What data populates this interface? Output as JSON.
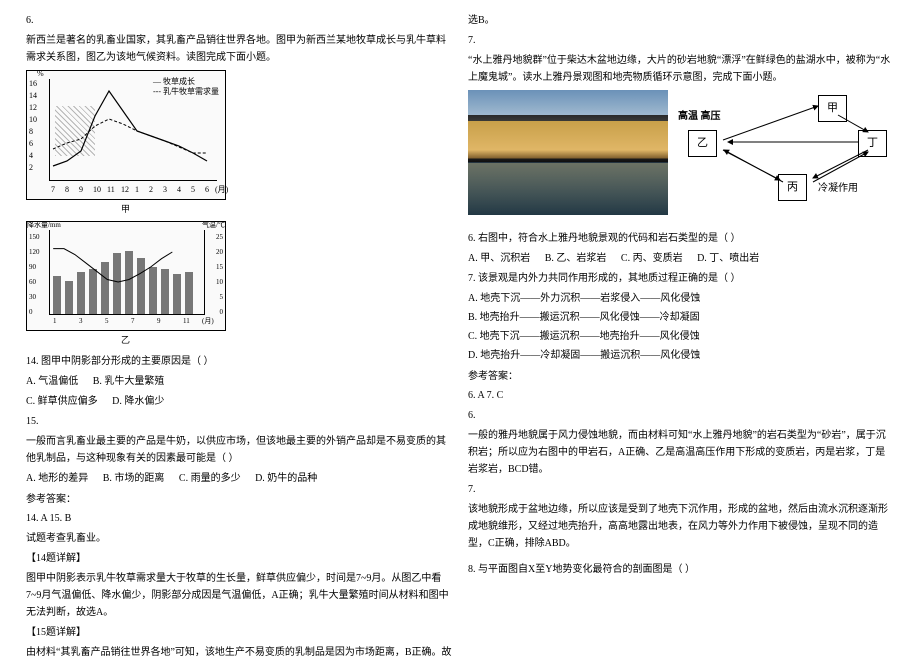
{
  "left": {
    "q6_num": "6.",
    "q6_intro": "新西兰是著名的乳畜业国家，其乳畜产品销往世界各地。图甲为新西兰某地牧草成长与乳牛草料需求关系图，图乙为该地气候资料。读图完成下面小题。",
    "chart1": {
      "y_unit": "%",
      "y_ticks": [
        "16",
        "14",
        "12",
        "10",
        "8",
        "6",
        "4",
        "2"
      ],
      "x_ticks": [
        "7",
        "8",
        "9",
        "10",
        "11",
        "12",
        "1",
        "2",
        "3",
        "4",
        "5",
        "6"
      ],
      "x_unit": "(月)",
      "legend_solid": "— 牧草成长",
      "legend_dash": "--- 乳牛牧草需求量",
      "label_jia": "甲"
    },
    "chart2": {
      "left_title": "降水量/mm",
      "right_title": "气温/℃",
      "y_left": [
        "150",
        "120",
        "90",
        "60",
        "30",
        "0"
      ],
      "y_right": [
        "25",
        "20",
        "15",
        "10",
        "5",
        "0"
      ],
      "x_ticks": [
        "1",
        "3",
        "5",
        "7",
        "9",
        "11"
      ],
      "x_unit": "(月)",
      "label_yi": "乙"
    },
    "q14_stem": "14. 图甲中阴影部分形成的主要原因是（  ）",
    "q14_opts": {
      "A": "A. 气温偏低",
      "B": "B. 乳牛大量繁殖",
      "C": "C. 鲜草供应偏多",
      "D": "D. 降水偏少"
    },
    "q15_num": "15.",
    "q15_stem": "一般而言乳畜业最主要的产品是牛奶，以供应市场，但该地最主要的外销产品却是不易变质的其他乳制品，与这种现象有关的因素最可能是（  ）",
    "q15_opts": {
      "A": "A. 地形的差异",
      "B": "B. 市场的距离",
      "C": "C. 雨量的多少",
      "D": "D. 奶牛的品种"
    },
    "ans_label": "参考答案：",
    "ans_line": "14. A    15. B",
    "ans_note": "试题考查乳畜业。",
    "explain14_title": "【14题详解】",
    "explain14_body": "图甲中阴影表示乳牛牧草需求量大于牧草的生长量，鲜草供应偏少，时间是7~9月。从图乙中看7~9月气温偏低、降水偏少，阴影部分成因是气温偏低，A正确；乳牛大量繁殖时间从材料和图中无法判断，故选A。",
    "explain15_title": "【15题详解】",
    "explain15_body": "由材料“其乳畜产品销往世界各地”可知，该地生产不易变质的乳制品是因为市场距离，B正确。故"
  },
  "right": {
    "cont": "选B。",
    "q7_num": "7.",
    "q7_intro": "“水上雅丹地貌群”位于柴达木盆地边缘，大片的砂岩地貌“漂浮”在鲜绿色的盐湖水中，被称为“水上魔鬼城”。读水上雅丹景观图和地壳物质循环示意图，完成下面小题。",
    "diagram": {
      "top_label": "高温 高压",
      "box_jia": "甲",
      "box_yi": "乙",
      "box_bing": "丙",
      "box_ding": "丁",
      "bottom_label": "冷凝作用"
    },
    "q6r_stem": "6. 右图中，符合水上雅丹地貌景观的代码和岩石类型的是（  ）",
    "q6r_opts": {
      "A": "A. 甲、沉积岩",
      "B": "B. 乙、岩浆岩",
      "C": "C. 丙、变质岩",
      "D": "D. 丁、喷出岩"
    },
    "q7r_stem": "7. 该景观是内外力共同作用形成的，其地质过程正确的是（  ）",
    "q7r_opts": {
      "A": "A. 地壳下沉——外力沉积——岩浆侵入——风化侵蚀",
      "B": "B. 地壳抬升——搬运沉积——风化侵蚀——冷却凝固",
      "C": "C. 地壳下沉——搬运沉积——地壳抬升——风化侵蚀",
      "D": "D. 地壳抬升——冷却凝固——搬运沉积——风化侵蚀"
    },
    "ans_label": "参考答案：",
    "ans_line": "6. A    7. C",
    "exp6_num": "6.",
    "exp6_body": "一般的雅丹地貌属于风力侵蚀地貌，而由材料可知“水上雅丹地貌”的岩石类型为“砂岩”，属于沉积岩；所以应为右图中的甲岩石，A正确、乙是高温高压作用下形成的变质岩，丙是岩浆，丁是岩浆岩，BCD错。",
    "exp7_num": "7.",
    "exp7_body": "该地貌形成于盆地边缘，所以应该是受到了地壳下沉作用，形成的盆地，然后由流水沉积逐渐形成地貌维形，又经过地壳抬升，高高地露出地表，在风力等外力作用下被侵蚀，呈现不同的造型，C正确，排除ABD。",
    "q8_stem": "8. 与平面图自X至Y地势变化最符合的剖面图是（  ）"
  },
  "chart_data": [
    {
      "type": "line",
      "title": "甲",
      "xlabel": "月",
      "ylabel": "%",
      "categories": [
        "7",
        "8",
        "9",
        "10",
        "11",
        "12",
        "1",
        "2",
        "3",
        "4",
        "5",
        "6"
      ],
      "ylim": [
        0,
        16
      ],
      "series": [
        {
          "name": "牧草成长",
          "values": [
            2,
            3,
            5,
            10,
            14,
            11,
            8,
            7,
            6,
            5,
            4,
            3
          ]
        },
        {
          "name": "乳牛牧草需求量",
          "values": [
            5,
            6,
            7,
            9,
            10,
            9,
            8,
            7,
            6,
            5,
            4,
            4
          ]
        }
      ]
    },
    {
      "type": "bar",
      "title": "乙",
      "xlabel": "月",
      "ylabel": "降水量/mm",
      "y2label": "气温/℃",
      "categories": [
        "1",
        "2",
        "3",
        "4",
        "5",
        "6",
        "7",
        "8",
        "9",
        "10",
        "11",
        "12"
      ],
      "ylim": [
        0,
        150
      ],
      "y2lim": [
        0,
        25
      ],
      "series": [
        {
          "name": "降水量",
          "axis": "left",
          "values": [
            80,
            70,
            90,
            95,
            110,
            130,
            135,
            120,
            100,
            95,
            85,
            90
          ]
        },
        {
          "name": "气温",
          "axis": "right",
          "values": [
            20,
            20,
            18,
            15,
            12,
            9,
            8,
            9,
            11,
            13,
            16,
            18
          ]
        }
      ]
    }
  ]
}
